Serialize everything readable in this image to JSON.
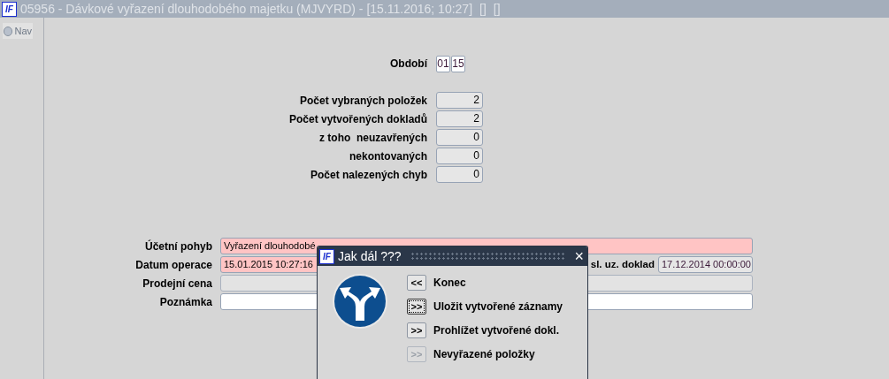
{
  "title_bar": {
    "logo": "IF",
    "title": "05956 - Dávkové vyřazení dlouhodobého majetku (MJVYRD) - [15.11.2016; 10:27]",
    "extras": [
      "[]",
      "[]"
    ]
  },
  "nav_tab": {
    "label": "Nav"
  },
  "period": {
    "label": "Období",
    "month": "01",
    "year": "15"
  },
  "counts": [
    {
      "label": "Počet vybraných položek",
      "value": "2"
    },
    {
      "label": "Počet vytvořených dokladů",
      "value": "2"
    },
    {
      "label": "z toho  neuzavřených",
      "value": "0"
    },
    {
      "label": "nekontovaných",
      "value": "0"
    },
    {
      "label": "Počet nalezených chyb",
      "value": "0"
    }
  ],
  "form": [
    {
      "label": "Účetní pohyb",
      "value": "Vyřazení dlouhodobé",
      "required": true,
      "disabled": false
    },
    {
      "label": "Datum operace",
      "value": "15.01.2015 10:27:16",
      "required": true,
      "disabled": false,
      "side_label": "sl. uz. doklad",
      "side_value": "17.12.2014 00:00:00"
    },
    {
      "label": "Prodejní cena",
      "required": false,
      "disabled": true
    },
    {
      "label": "Poznámka",
      "required": false,
      "disabled": false
    }
  ],
  "dialog": {
    "logo": "IF",
    "title": "Jak dál ???",
    "close": "×",
    "options": [
      {
        "button": "<<",
        "label": "Konec",
        "focused": false,
        "disabled": false
      },
      {
        "button": ">>",
        "label": "Uložit vytvořené záznamy",
        "focused": true,
        "disabled": false
      },
      {
        "button": ">>",
        "label": "Prohlížet vytvořené dokl.",
        "focused": false,
        "disabled": false
      },
      {
        "button": ">>",
        "label": "Nevyřazené položky",
        "focused": false,
        "disabled": true
      }
    ]
  }
}
